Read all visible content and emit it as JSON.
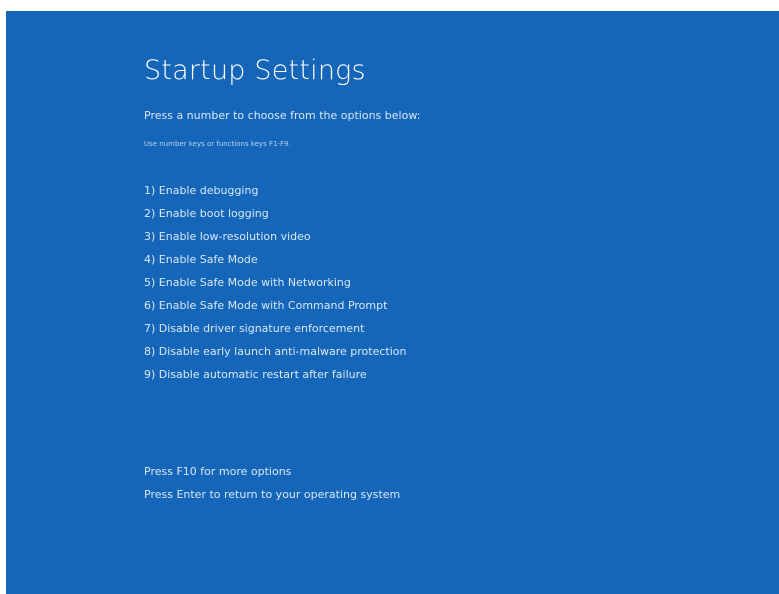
{
  "screen": {
    "title": "Startup Settings",
    "subtitle": "Press a number to choose from the options below:",
    "hint": "Use number keys or functions keys F1-F9.",
    "background_color": "#1565b8"
  },
  "options": [
    "1) Enable debugging",
    "2) Enable boot logging",
    "3) Enable low-resolution video",
    "4) Enable Safe Mode",
    "5) Enable Safe Mode with Networking",
    "6) Enable Safe Mode with Command Prompt",
    "7) Disable driver signature enforcement",
    "8) Disable early launch anti-malware protection",
    "9) Disable automatic restart after failure"
  ],
  "footer": {
    "more_options": "Press F10 for more options",
    "return_os": "Press Enter to return to your operating system"
  }
}
